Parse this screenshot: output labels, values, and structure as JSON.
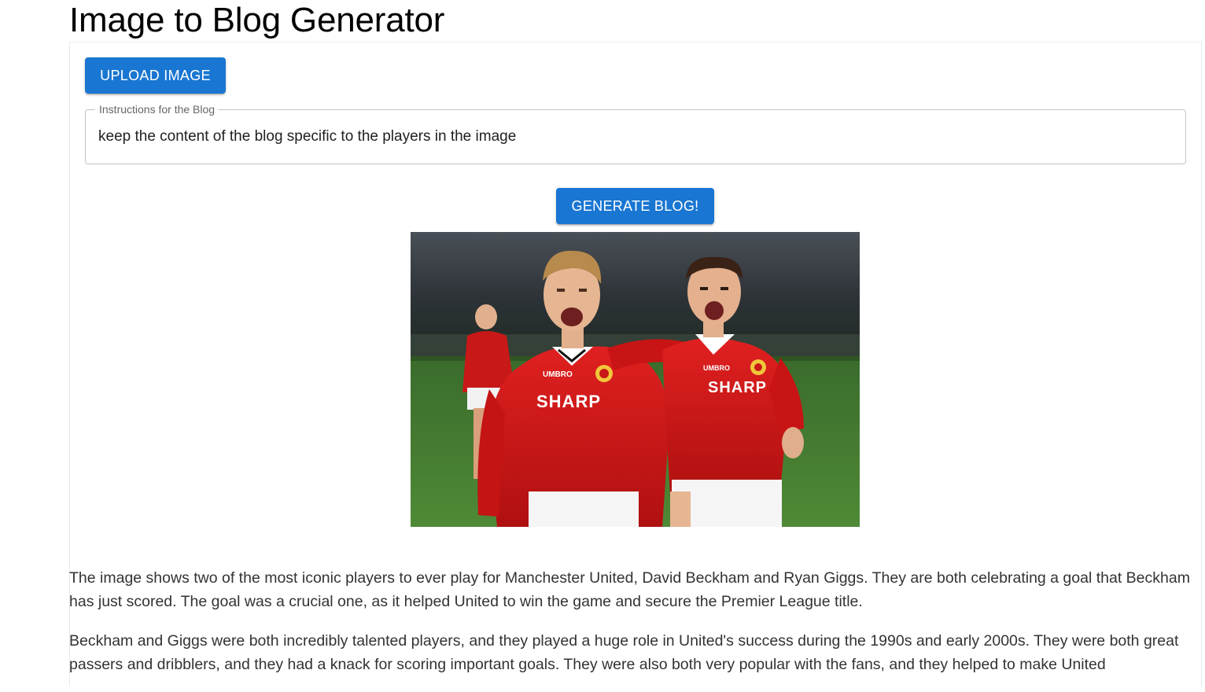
{
  "header": {
    "title": "Image to Blog Generator"
  },
  "form": {
    "upload_label": "Upload Image",
    "instructions_label": "Instructions for the Blog",
    "instructions_value": "keep the content of the blog specific to the players in the image",
    "generate_label": "Generate Blog!"
  },
  "photo": {
    "jersey_sponsor_left": "SHARP",
    "jersey_sponsor_right": "SHARP",
    "kit_maker": "UMBRO"
  },
  "blog": {
    "paragraphs": [
      "The image shows two of the most iconic players to ever play for Manchester United, David Beckham and Ryan Giggs. They are both celebrating a goal that Beckham has just scored. The goal was a crucial one, as it helped United to win the game and secure the Premier League title.",
      "Beckham and Giggs were both incredibly talented players, and they played a huge role in United's success during the 1990s and early 2000s. They were both great passers and dribblers, and they had a knack for scoring important goals. They were also both very popular with the fans, and they helped to make United"
    ]
  },
  "colors": {
    "primary": "#1976d2",
    "jersey_red": "#d41a1a",
    "pitch_green": "#3f7a2c"
  }
}
